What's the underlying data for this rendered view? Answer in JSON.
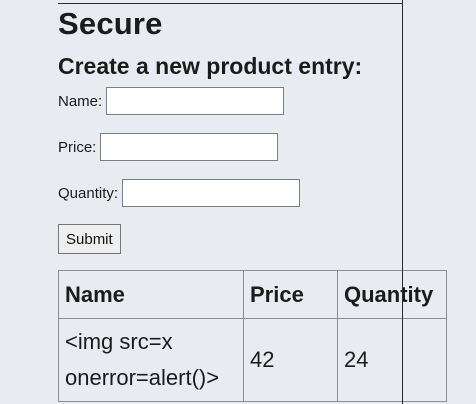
{
  "page": {
    "title": "Secure",
    "subtitle": "Create a new product entry:"
  },
  "form": {
    "name_label": "Name:",
    "name_value": "",
    "price_label": "Price:",
    "price_value": "",
    "quantity_label": "Quantity:",
    "quantity_value": "",
    "submit_label": "Submit"
  },
  "table": {
    "headers": [
      "Name",
      "Price",
      "Quantity"
    ],
    "rows": [
      {
        "name": "<img src=x onerror=alert()>",
        "price": "42",
        "quantity": "24"
      }
    ]
  }
}
